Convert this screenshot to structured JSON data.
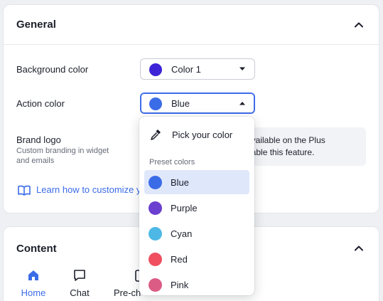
{
  "general": {
    "title": "General",
    "background_color": {
      "label": "Background color",
      "value": "Color 1",
      "swatch": "#3d24d6"
    },
    "action_color": {
      "label": "Action color",
      "value": "Blue",
      "swatch": "#3b6ce8"
    },
    "brand_logo": {
      "label": "Brand logo",
      "description": "Custom branding in widget and emails",
      "info_line1": "available on the Plus",
      "info_line2": "nable this feature."
    },
    "learn_link": "Learn how to customize y"
  },
  "dropdown": {
    "pick_label": "Pick your color",
    "preset_heading": "Preset colors",
    "options": [
      {
        "label": "Blue",
        "color": "#3b6ce8",
        "selected": true
      },
      {
        "label": "Purple",
        "color": "#6b3fd0",
        "selected": false
      },
      {
        "label": "Cyan",
        "color": "#4db8e6",
        "selected": false
      },
      {
        "label": "Red",
        "color": "#ef4f5f",
        "selected": false
      },
      {
        "label": "Pink",
        "color": "#db5c84",
        "selected": false
      }
    ]
  },
  "content": {
    "title": "Content",
    "tabs": [
      {
        "label": "Home",
        "icon": "home-icon",
        "active": true
      },
      {
        "label": "Chat",
        "icon": "chat-icon",
        "active": false
      },
      {
        "label": "Pre-ch",
        "icon": "form-icon",
        "active": false
      }
    ]
  }
}
